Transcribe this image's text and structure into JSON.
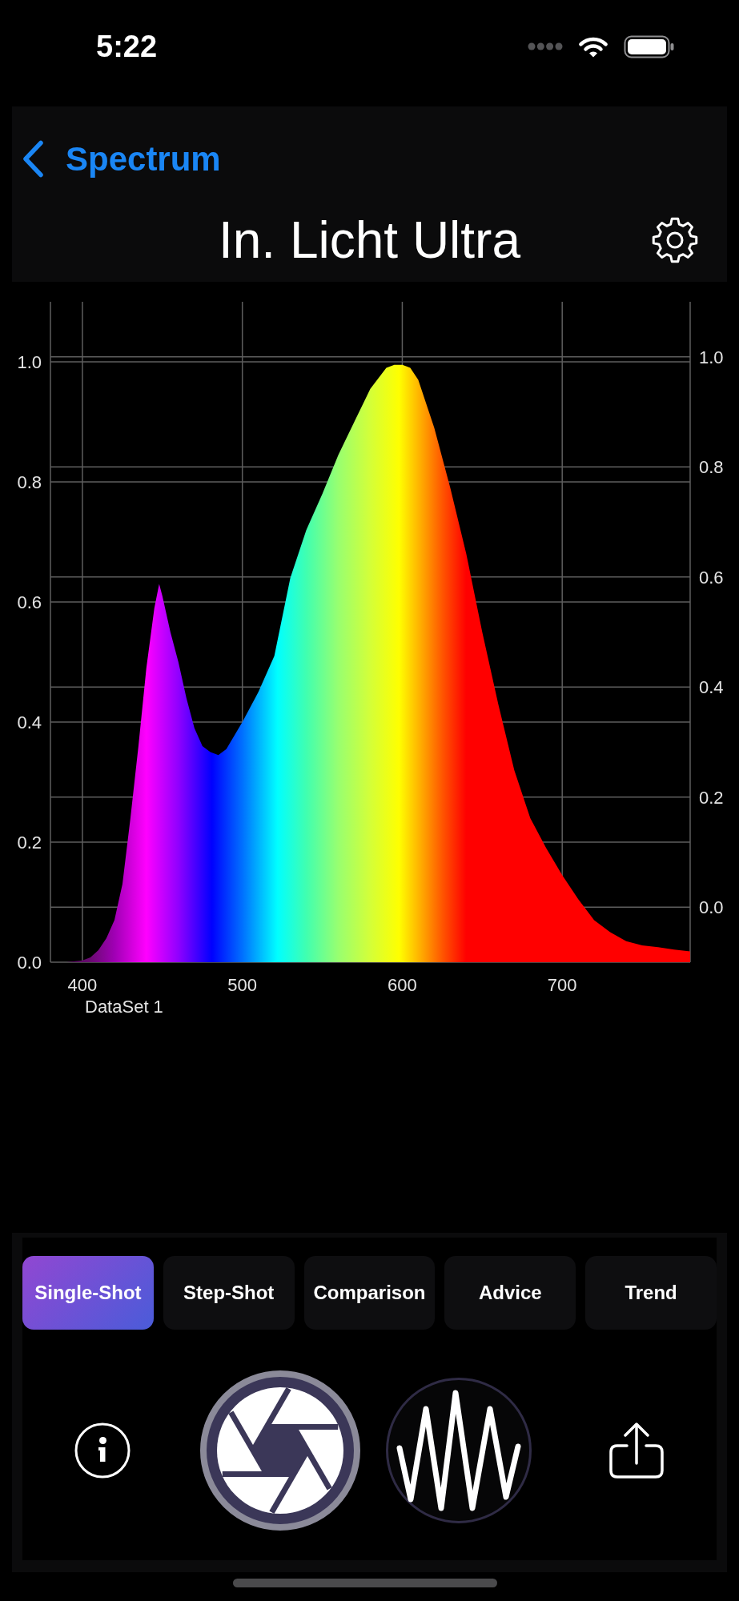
{
  "status_bar": {
    "time": "5:22"
  },
  "navigation": {
    "back_label": "Spectrum",
    "title": "In. Licht Ultra"
  },
  "chart": {
    "chart_data": {
      "type": "area",
      "grid": true,
      "xlim": [
        380,
        780
      ],
      "ylim": [
        0,
        1.1
      ],
      "xticks": [
        400,
        500,
        600,
        700
      ],
      "yticks": [
        {
          "value": 0,
          "label": "0.0"
        },
        {
          "value": 0.2,
          "label": "0.2"
        },
        {
          "value": 0.4,
          "label": "0.4"
        },
        {
          "value": 0.6,
          "label": "0.6"
        },
        {
          "value": 0.8,
          "label": "0.8"
        },
        {
          "value": 1,
          "label": "1.0"
        }
      ],
      "y2lim": [
        -0.1,
        1.1
      ],
      "y2ticks": [
        {
          "value": 0,
          "label": "0.0"
        },
        {
          "value": 0.2,
          "label": "0.2"
        },
        {
          "value": 0.4,
          "label": "0.4"
        },
        {
          "value": 0.6,
          "label": "0.6"
        },
        {
          "value": 0.8,
          "label": "0.8"
        },
        {
          "value": 1,
          "label": "1.0"
        }
      ],
      "x": [
        380,
        390,
        400,
        405,
        410,
        415,
        420,
        425,
        430,
        435,
        440,
        445,
        448,
        450,
        455,
        460,
        465,
        470,
        475,
        480,
        485,
        490,
        500,
        510,
        520,
        530,
        540,
        550,
        560,
        570,
        580,
        590,
        595,
        600,
        605,
        610,
        620,
        630,
        640,
        650,
        660,
        670,
        680,
        690,
        700,
        710,
        720,
        730,
        740,
        750,
        760,
        770,
        780
      ],
      "series": [
        {
          "name": "DataSet 1",
          "values": [
            0,
            0,
            0.003,
            0.008,
            0.02,
            0.04,
            0.07,
            0.13,
            0.24,
            0.36,
            0.49,
            0.59,
            0.63,
            0.61,
            0.55,
            0.5,
            0.44,
            0.39,
            0.36,
            0.35,
            0.345,
            0.355,
            0.4,
            0.45,
            0.51,
            0.64,
            0.72,
            0.78,
            0.845,
            0.9,
            0.955,
            0.99,
            0.995,
            0.995,
            0.99,
            0.97,
            0.89,
            0.79,
            0.68,
            0.55,
            0.43,
            0.32,
            0.24,
            0.19,
            0.145,
            0.105,
            0.07,
            0.05,
            0.035,
            0.028,
            0.025,
            0.021,
            0.018
          ]
        }
      ]
    }
  },
  "tabs": [
    {
      "label": "Single-Shot",
      "selected": true
    },
    {
      "label": "Step-Shot",
      "selected": false
    },
    {
      "label": "Comparison",
      "selected": false
    },
    {
      "label": "Advice",
      "selected": false
    },
    {
      "label": "Trend",
      "selected": false
    }
  ]
}
